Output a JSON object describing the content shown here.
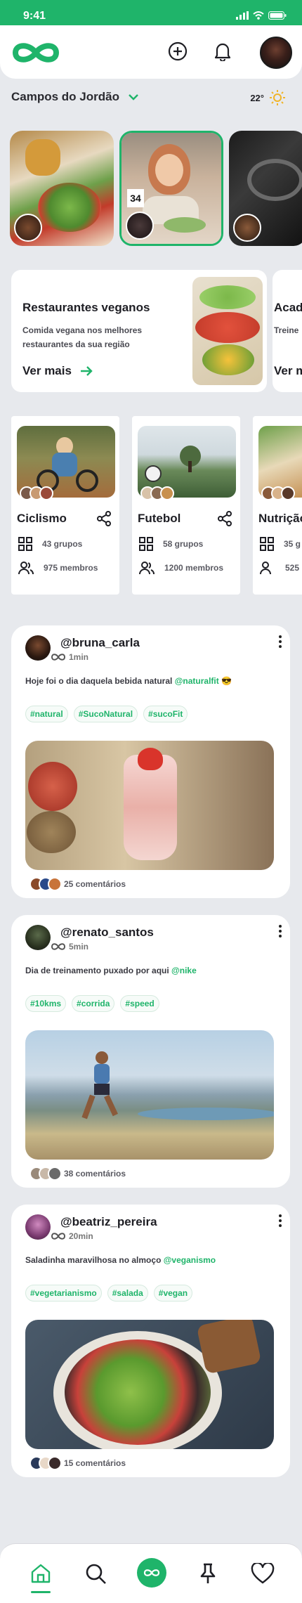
{
  "status_bar": {
    "time": "9:41"
  },
  "location": {
    "city": "Campos do Jordão",
    "temperature": "22°"
  },
  "highlights": [
    {
      "title": "Restaurantes veganos",
      "description": "Comida vegana nos melhores restaurantes da sua região",
      "cta": "Ver mais"
    },
    {
      "title": "Acad",
      "description": "Treine",
      "cta": "Ver m"
    }
  ],
  "groups": [
    {
      "title": "Ciclismo",
      "groups_count": "43 grupos",
      "members_count": "975 membros"
    },
    {
      "title": "Futebol",
      "groups_count": "58 grupos",
      "members_count": "1200 membros"
    },
    {
      "title": "Nutrição",
      "groups_count": "35 g",
      "members_count": "525"
    }
  ],
  "posts": [
    {
      "username": "@bruna_carla",
      "time": "1min",
      "text": "Hoje foi o dia daquela bebida natural ",
      "mention": "@naturalfit",
      "emoji": "😎",
      "tags": [
        "#natural",
        "#SucoNatural",
        "#sucoFit"
      ],
      "comments": "25 comentários"
    },
    {
      "username": "@renato_santos",
      "time": "5min",
      "text": "Dia de treinamento puxado por aqui ",
      "mention": "@nike",
      "emoji": "",
      "tags": [
        "#10kms",
        "#corrida",
        "#speed"
      ],
      "comments": "38 comentários"
    },
    {
      "username": "@beatriz_pereira",
      "time": "20min",
      "text": "Saladinha maravilhosa no almoço ",
      "mention": "@veganismo",
      "emoji": "",
      "tags": [
        "#vegetarianismo",
        "#salada",
        "#vegan"
      ],
      "comments": "15 comentários"
    }
  ],
  "story_badge": "34",
  "colors": {
    "accent": "#1fb46a",
    "background": "#e7e9ed",
    "card": "#ffffff"
  },
  "icons": [
    "infinity-logo-icon",
    "plus-circle-icon",
    "bell-icon",
    "chevron-down-icon",
    "sun-icon",
    "arrow-right-icon",
    "share-icon",
    "grid-icon",
    "users-icon",
    "kebab-icon",
    "home-icon",
    "search-icon",
    "infinity-icon",
    "pin-icon",
    "heart-icon"
  ]
}
